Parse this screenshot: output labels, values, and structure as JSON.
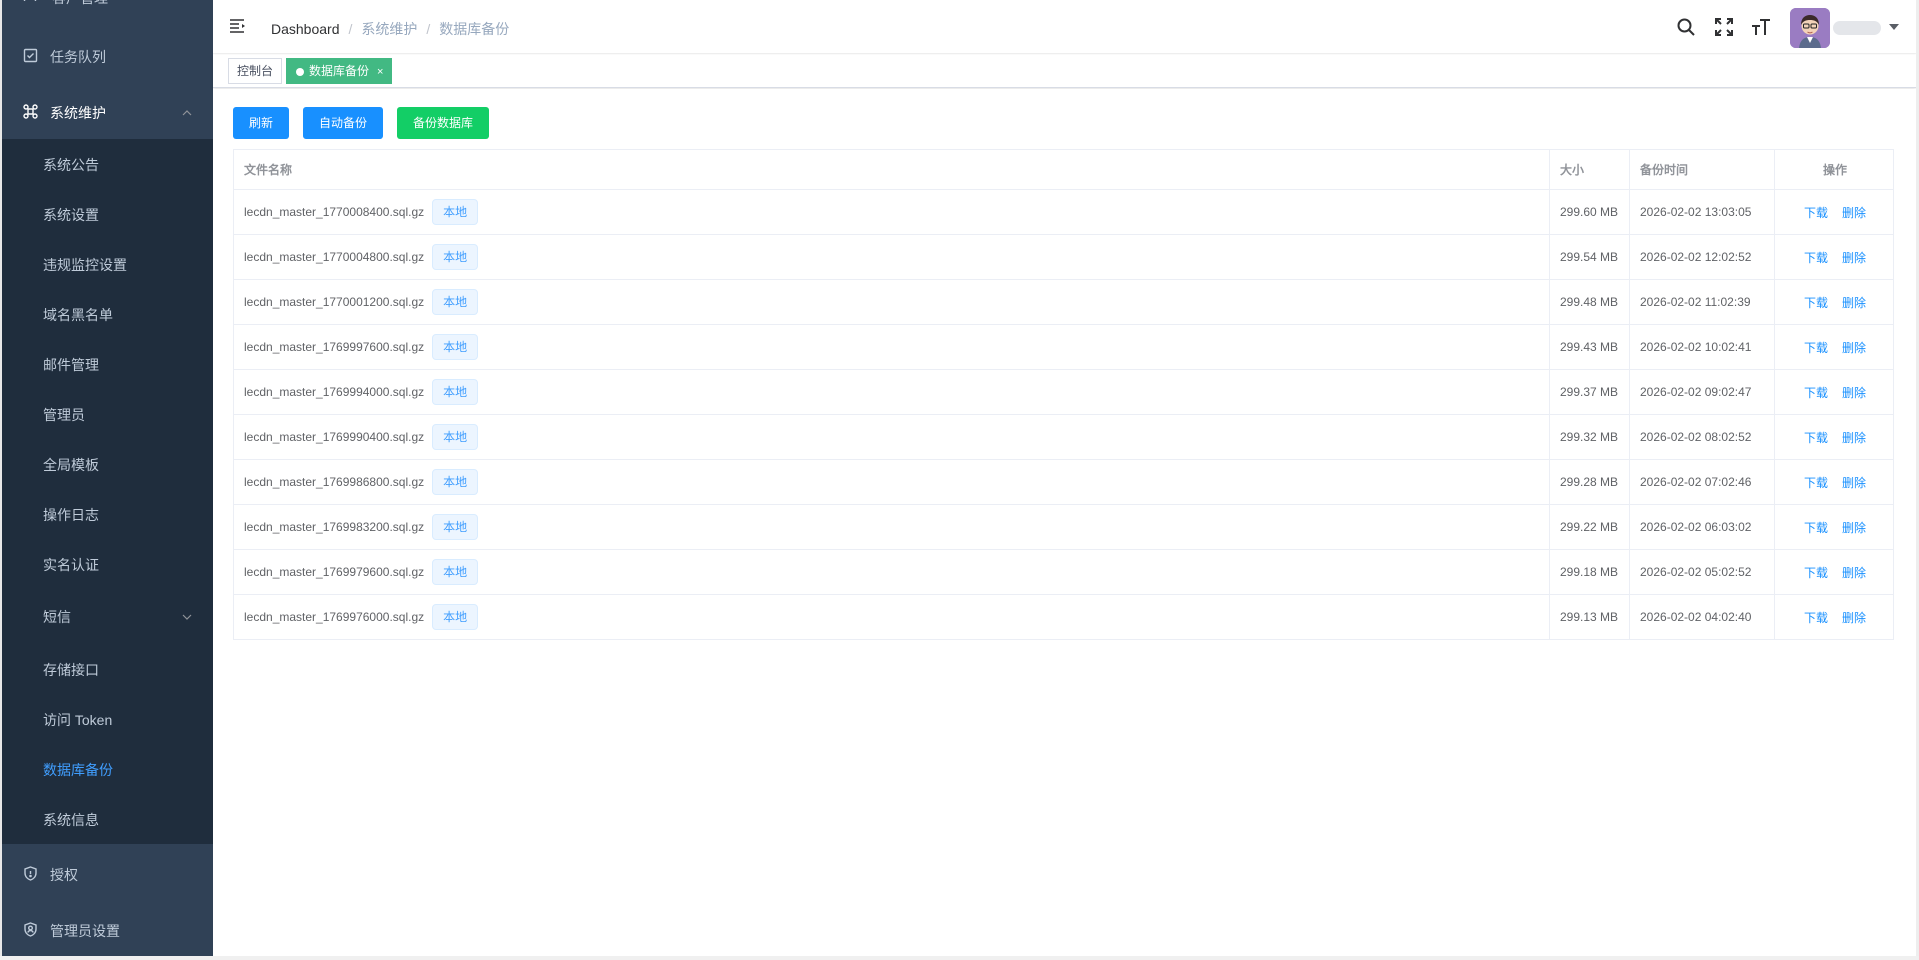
{
  "sidebar": {
    "cut_item": {
      "label": "客户管理",
      "icon": "user-icon"
    },
    "top_items": [
      {
        "label": "任务队列",
        "icon": "checkbox-icon"
      },
      {
        "label": "系统维护",
        "icon": "command-icon"
      }
    ],
    "sub_items": [
      {
        "label": "系统公告"
      },
      {
        "label": "系统设置"
      },
      {
        "label": "违规监控设置"
      },
      {
        "label": "域名黑名单"
      },
      {
        "label": "邮件管理"
      },
      {
        "label": "管理员"
      },
      {
        "label": "全局模板"
      },
      {
        "label": "操作日志"
      },
      {
        "label": "实名认证"
      },
      {
        "label": "短信"
      },
      {
        "label": "存储接口"
      },
      {
        "label": "访问 Token"
      },
      {
        "label": "数据库备份"
      },
      {
        "label": "系统信息"
      }
    ],
    "bottom_items": [
      {
        "label": "授权",
        "icon": "shield-icon"
      },
      {
        "label": "管理员设置",
        "icon": "admin-shield-icon"
      }
    ],
    "active_color": "#409eff"
  },
  "navbar": {
    "breadcrumb": [
      "Dashboard",
      "系统维护",
      "数据库备份"
    ]
  },
  "tags": {
    "items": [
      {
        "label": "控制台"
      },
      {
        "label": "数据库备份",
        "close": "×"
      }
    ],
    "active_color": "#42b983"
  },
  "toolbar": {
    "refresh_label": "刷新",
    "auto_backup_label": "自动备份",
    "backup_db_label": "备份数据库"
  },
  "table": {
    "headers": {
      "name": "文件名称",
      "size": "大小",
      "time": "备份时间",
      "actions": "操作"
    },
    "location_label": "本地",
    "download_label": "下载",
    "delete_label": "删除",
    "rows": [
      {
        "name": "lecdn_master_1770008400.sql.gz",
        "size": "299.60 MB",
        "time": "2026-02-02 13:03:05"
      },
      {
        "name": "lecdn_master_1770004800.sql.gz",
        "size": "299.54 MB",
        "time": "2026-02-02 12:02:52"
      },
      {
        "name": "lecdn_master_1770001200.sql.gz",
        "size": "299.48 MB",
        "time": "2026-02-02 11:02:39"
      },
      {
        "name": "lecdn_master_1769997600.sql.gz",
        "size": "299.43 MB",
        "time": "2026-02-02 10:02:41"
      },
      {
        "name": "lecdn_master_1769994000.sql.gz",
        "size": "299.37 MB",
        "time": "2026-02-02 09:02:47"
      },
      {
        "name": "lecdn_master_1769990400.sql.gz",
        "size": "299.32 MB",
        "time": "2026-02-02 08:02:52"
      },
      {
        "name": "lecdn_master_1769986800.sql.gz",
        "size": "299.28 MB",
        "time": "2026-02-02 07:02:46"
      },
      {
        "name": "lecdn_master_1769983200.sql.gz",
        "size": "299.22 MB",
        "time": "2026-02-02 06:03:02"
      },
      {
        "name": "lecdn_master_1769979600.sql.gz",
        "size": "299.18 MB",
        "time": "2026-02-02 05:02:52"
      },
      {
        "name": "lecdn_master_1769976000.sql.gz",
        "size": "299.13 MB",
        "time": "2026-02-02 04:02:40"
      }
    ]
  }
}
